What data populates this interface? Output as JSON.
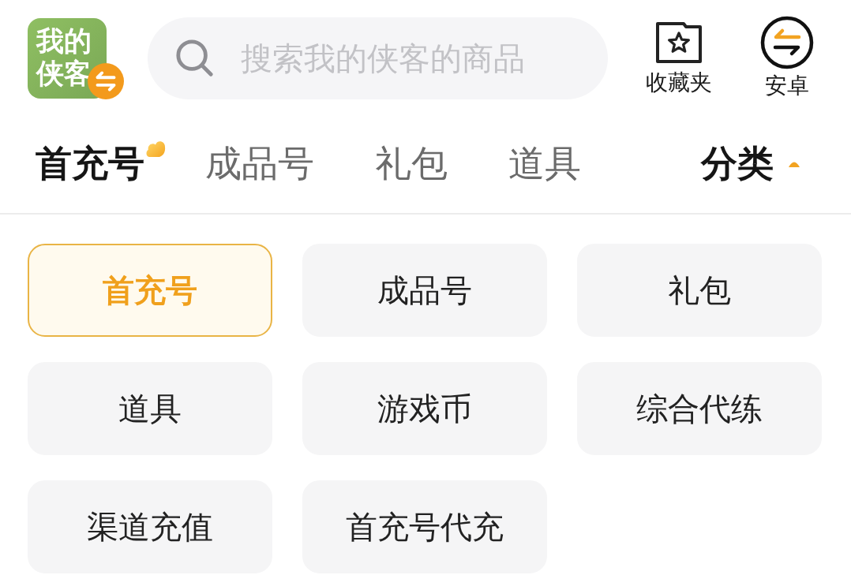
{
  "header": {
    "logo": {
      "text": "我的侠客"
    },
    "search": {
      "placeholder": "搜索我的侠客的商品"
    },
    "actions": [
      {
        "kind": "favorites",
        "label": "收藏夹"
      },
      {
        "kind": "platform",
        "label": "安卓"
      }
    ]
  },
  "tabs": [
    {
      "label": "首充号",
      "selected": true
    },
    {
      "label": "成品号",
      "selected": false
    },
    {
      "label": "礼包",
      "selected": false
    },
    {
      "label": "道具",
      "selected": false
    }
  ],
  "category_toggle": {
    "label": "分类",
    "expanded": true
  },
  "categories": [
    {
      "label": "首充号",
      "selected": true
    },
    {
      "label": "成品号",
      "selected": false
    },
    {
      "label": "礼包",
      "selected": false
    },
    {
      "label": "道具",
      "selected": false
    },
    {
      "label": "游戏币",
      "selected": false
    },
    {
      "label": "综合代练",
      "selected": false
    },
    {
      "label": "渠道充值",
      "selected": false
    },
    {
      "label": "首充号代充",
      "selected": false
    }
  ]
}
